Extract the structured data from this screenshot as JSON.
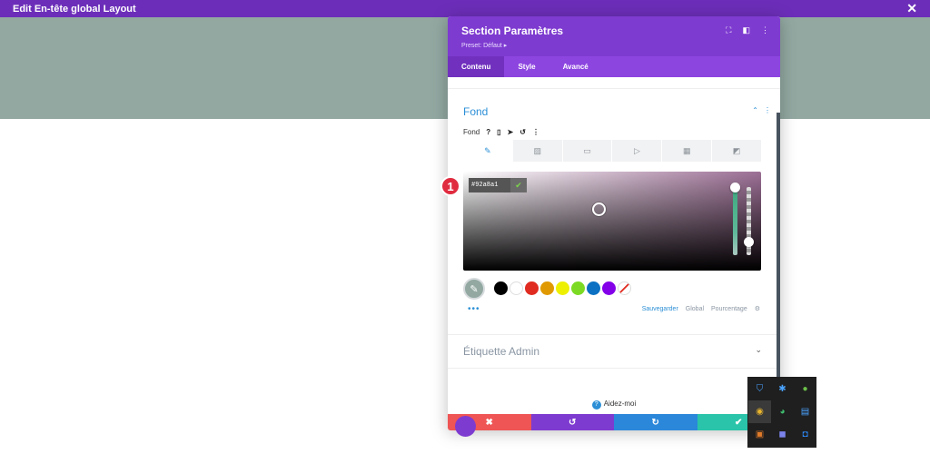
{
  "topbar": {
    "title": "Edit En-tête global Layout",
    "close_icon": "close-icon",
    "close_glyph": "✕"
  },
  "panel": {
    "title": "Section Paramètres",
    "preset": "Preset: Défaut ▸",
    "header_icons": [
      "fullscreen-icon",
      "split-view-icon",
      "more-options-icon"
    ],
    "tabs": [
      {
        "label": "Contenu",
        "active": true
      },
      {
        "label": "Style",
        "active": false
      },
      {
        "label": "Avancé",
        "active": false
      }
    ]
  },
  "background": {
    "section_title": "Fond",
    "sub_label": "Fond",
    "type_tabs": [
      "color-icon",
      "gradient-icon",
      "image-icon",
      "video-icon",
      "pattern-icon",
      "mask-icon"
    ],
    "hex_value": "#92a8a1",
    "swatches": [
      "#000000",
      "#ffffff",
      "#e02b20",
      "#e09900",
      "#edf000",
      "#7cda24",
      "#0c71c3",
      "#8300e9"
    ],
    "actions": {
      "save": "Sauvegarder",
      "global": "Global",
      "percent": "Pourcentage"
    }
  },
  "admin_label": {
    "title": "Étiquette Admin"
  },
  "help": {
    "label": "Aidez-moi"
  },
  "footer": [
    {
      "name": "discard-button",
      "icon": "close-icon",
      "glyph": "✖",
      "color": "#ef5555"
    },
    {
      "name": "undo-button",
      "icon": "undo-icon",
      "glyph": "↺",
      "color": "#7e3bd0"
    },
    {
      "name": "redo-button",
      "icon": "redo-icon",
      "glyph": "↻",
      "color": "#2b87da"
    },
    {
      "name": "save-button",
      "icon": "check-icon",
      "glyph": "✔",
      "color": "#29c4a9"
    }
  ],
  "badge": {
    "number": "1"
  },
  "colors": {
    "accent": "#7e3bd0",
    "blue": "#2c8fd6",
    "hero": "#92a8a1"
  }
}
